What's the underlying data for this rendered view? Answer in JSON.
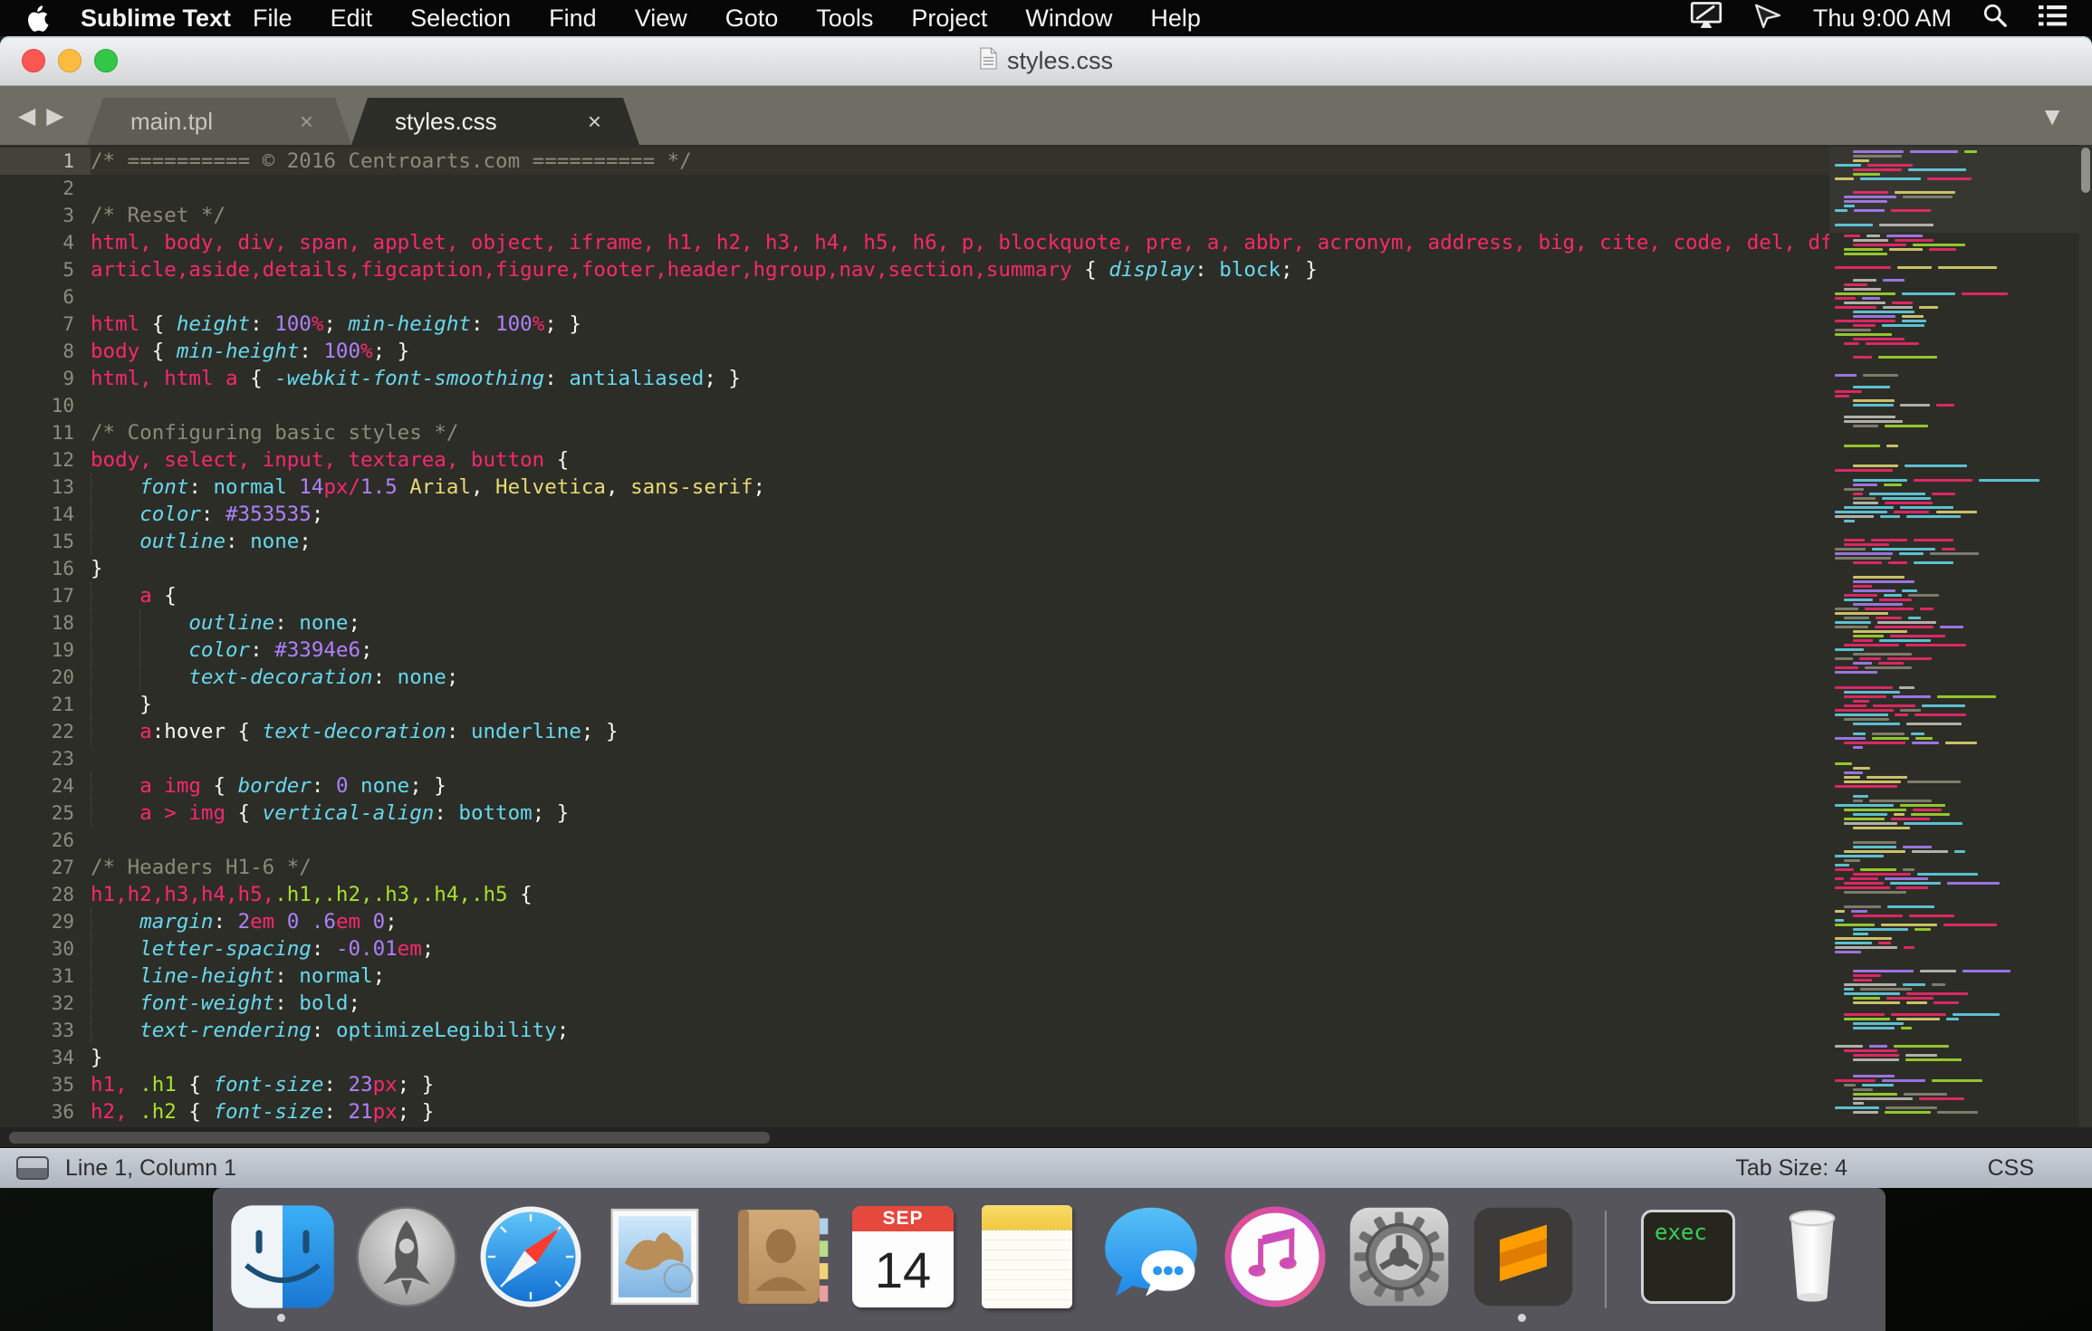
{
  "menu_bar": {
    "app_name": "Sublime Text",
    "items": [
      "File",
      "Edit",
      "Selection",
      "Find",
      "View",
      "Goto",
      "Tools",
      "Project",
      "Window",
      "Help"
    ],
    "clock": "Thu 9:00 AM"
  },
  "window": {
    "title": "styles.css"
  },
  "tab_bar": {
    "close_glyph": "×",
    "back_glyph": "◀",
    "forward_glyph": "▶",
    "overflow_glyph": "▼",
    "tabs": [
      {
        "label": "main.tpl",
        "active": false
      },
      {
        "label": "styles.css",
        "active": true
      }
    ]
  },
  "status_bar": {
    "position": "Line 1, Column 1",
    "tab_size": "Tab Size: 4",
    "syntax": "CSS"
  },
  "colors": {
    "editor_bg": "#2d2d27",
    "comment": "#8b8b79",
    "selector_pink": "#f9286e",
    "class_green": "#a6e22e",
    "property_cyan": "#66d9ef",
    "number_purple": "#ae81ff",
    "string_yellow": "#e6db74",
    "plain_white": "#f8f8f2"
  },
  "editor": {
    "lines": [
      {
        "n": 1,
        "i": 0,
        "t": [
          [
            "c",
            "/* ========== © 2016 Centroarts.com ========== */"
          ]
        ]
      },
      {
        "n": 2,
        "i": 0,
        "t": []
      },
      {
        "n": 3,
        "i": 0,
        "t": [
          [
            "c",
            "/* Reset */"
          ]
        ]
      },
      {
        "n": 4,
        "i": 0,
        "t": [
          [
            "s",
            "html, body, div, span, applet, object, iframe, h1, h2, h3, h4, h5, h6, p, blockquote, pre, a, abbr, acronym, address, big, cite, code, del, dfn"
          ]
        ]
      },
      {
        "n": 5,
        "i": 0,
        "t": [
          [
            "s",
            "article,aside,details,figcaption,figure,footer,header,hgroup,nav,section,summary"
          ],
          [
            "w",
            " { "
          ],
          [
            "p",
            "display"
          ],
          [
            "w",
            ": "
          ],
          [
            "k",
            "block"
          ],
          [
            "w",
            "; }"
          ]
        ]
      },
      {
        "n": 6,
        "i": 0,
        "t": []
      },
      {
        "n": 7,
        "i": 0,
        "t": [
          [
            "s",
            "html"
          ],
          [
            "w",
            " { "
          ],
          [
            "p",
            "height"
          ],
          [
            "w",
            ": "
          ],
          [
            "n",
            "100"
          ],
          [
            "u",
            "%"
          ],
          [
            "w",
            "; "
          ],
          [
            "p",
            "min-height"
          ],
          [
            "w",
            ": "
          ],
          [
            "n",
            "100"
          ],
          [
            "u",
            "%"
          ],
          [
            "w",
            "; }"
          ]
        ]
      },
      {
        "n": 8,
        "i": 0,
        "t": [
          [
            "s",
            "body"
          ],
          [
            "w",
            " { "
          ],
          [
            "p",
            "min-height"
          ],
          [
            "w",
            ": "
          ],
          [
            "n",
            "100"
          ],
          [
            "u",
            "%"
          ],
          [
            "w",
            "; }"
          ]
        ]
      },
      {
        "n": 9,
        "i": 0,
        "t": [
          [
            "s",
            "html, html a"
          ],
          [
            "w",
            " { "
          ],
          [
            "p",
            "-webkit-font-smoothing"
          ],
          [
            "w",
            ": "
          ],
          [
            "k",
            "antialiased"
          ],
          [
            "w",
            "; }"
          ]
        ]
      },
      {
        "n": 10,
        "i": 0,
        "t": []
      },
      {
        "n": 11,
        "i": 0,
        "t": [
          [
            "c",
            "/* Configuring basic styles */"
          ]
        ]
      },
      {
        "n": 12,
        "i": 0,
        "t": [
          [
            "s",
            "body, select, input, textarea, button"
          ],
          [
            "w",
            " {"
          ]
        ]
      },
      {
        "n": 13,
        "i": 1,
        "t": [
          [
            "w",
            "    "
          ],
          [
            "p",
            "font"
          ],
          [
            "w",
            ": "
          ],
          [
            "k",
            "normal"
          ],
          [
            "w",
            " "
          ],
          [
            "n",
            "14"
          ],
          [
            "u",
            "px"
          ],
          [
            "o",
            "/"
          ],
          [
            "n",
            "1.5"
          ],
          [
            "w",
            " "
          ],
          [
            "y",
            "Arial"
          ],
          [
            "w",
            ", "
          ],
          [
            "y",
            "Helvetica"
          ],
          [
            "w",
            ", "
          ],
          [
            "y",
            "sans-serif"
          ],
          [
            "w",
            ";"
          ]
        ]
      },
      {
        "n": 14,
        "i": 1,
        "t": [
          [
            "w",
            "    "
          ],
          [
            "p",
            "color"
          ],
          [
            "w",
            ": "
          ],
          [
            "n",
            "#353535"
          ],
          [
            "w",
            ";"
          ]
        ]
      },
      {
        "n": 15,
        "i": 1,
        "t": [
          [
            "w",
            "    "
          ],
          [
            "p",
            "outline"
          ],
          [
            "w",
            ": "
          ],
          [
            "k",
            "none"
          ],
          [
            "w",
            ";"
          ]
        ]
      },
      {
        "n": 16,
        "i": 0,
        "t": [
          [
            "w",
            "}"
          ]
        ]
      },
      {
        "n": 17,
        "i": 1,
        "t": [
          [
            "w",
            "    "
          ],
          [
            "s",
            "a"
          ],
          [
            "w",
            " {"
          ]
        ]
      },
      {
        "n": 18,
        "i": 2,
        "t": [
          [
            "w",
            "        "
          ],
          [
            "p",
            "outline"
          ],
          [
            "w",
            ": "
          ],
          [
            "k",
            "none"
          ],
          [
            "w",
            ";"
          ]
        ]
      },
      {
        "n": 19,
        "i": 2,
        "t": [
          [
            "w",
            "        "
          ],
          [
            "p",
            "color"
          ],
          [
            "w",
            ": "
          ],
          [
            "n",
            "#3394e6"
          ],
          [
            "w",
            ";"
          ]
        ]
      },
      {
        "n": 20,
        "i": 2,
        "t": [
          [
            "w",
            "        "
          ],
          [
            "p",
            "text-decoration"
          ],
          [
            "w",
            ": "
          ],
          [
            "k",
            "none"
          ],
          [
            "w",
            ";"
          ]
        ]
      },
      {
        "n": 21,
        "i": 1,
        "t": [
          [
            "w",
            "    "
          ],
          [
            "w",
            "}"
          ]
        ]
      },
      {
        "n": 22,
        "i": 1,
        "t": [
          [
            "w",
            "    "
          ],
          [
            "s",
            "a"
          ],
          [
            "w",
            ":hover { "
          ],
          [
            "p",
            "text-decoration"
          ],
          [
            "w",
            ": "
          ],
          [
            "k",
            "underline"
          ],
          [
            "w",
            "; }"
          ]
        ]
      },
      {
        "n": 23,
        "i": 0,
        "t": []
      },
      {
        "n": 24,
        "i": 1,
        "t": [
          [
            "w",
            "    "
          ],
          [
            "s",
            "a img"
          ],
          [
            "w",
            " { "
          ],
          [
            "p",
            "border"
          ],
          [
            "w",
            ": "
          ],
          [
            "n",
            "0"
          ],
          [
            "w",
            " "
          ],
          [
            "k",
            "none"
          ],
          [
            "w",
            "; }"
          ]
        ]
      },
      {
        "n": 25,
        "i": 1,
        "t": [
          [
            "w",
            "    "
          ],
          [
            "s",
            "a"
          ],
          [
            "w",
            " "
          ],
          [
            "o",
            ">"
          ],
          [
            "w",
            " "
          ],
          [
            "s",
            "img"
          ],
          [
            "w",
            " { "
          ],
          [
            "p",
            "vertical-align"
          ],
          [
            "w",
            ": "
          ],
          [
            "k",
            "bottom"
          ],
          [
            "w",
            "; }"
          ]
        ]
      },
      {
        "n": 26,
        "i": 0,
        "t": []
      },
      {
        "n": 27,
        "i": 0,
        "t": [
          [
            "c",
            "/* Headers H1-6 */"
          ]
        ]
      },
      {
        "n": 28,
        "i": 0,
        "t": [
          [
            "s",
            "h1,h2,h3,h4,h5,"
          ],
          [
            "g",
            ".h1,.h2,.h3,.h4,.h5"
          ],
          [
            "w",
            " {"
          ]
        ]
      },
      {
        "n": 29,
        "i": 1,
        "t": [
          [
            "w",
            "    "
          ],
          [
            "p",
            "margin"
          ],
          [
            "w",
            ": "
          ],
          [
            "n",
            "2"
          ],
          [
            "u",
            "em"
          ],
          [
            "w",
            " "
          ],
          [
            "n",
            "0"
          ],
          [
            "w",
            " "
          ],
          [
            "n",
            ".6"
          ],
          [
            "u",
            "em"
          ],
          [
            "w",
            " "
          ],
          [
            "n",
            "0"
          ],
          [
            "w",
            ";"
          ]
        ]
      },
      {
        "n": 30,
        "i": 1,
        "t": [
          [
            "w",
            "    "
          ],
          [
            "p",
            "letter-spacing"
          ],
          [
            "w",
            ": "
          ],
          [
            "n",
            "-0.01"
          ],
          [
            "u",
            "em"
          ],
          [
            "w",
            ";"
          ]
        ]
      },
      {
        "n": 31,
        "i": 1,
        "t": [
          [
            "w",
            "    "
          ],
          [
            "p",
            "line-height"
          ],
          [
            "w",
            ": "
          ],
          [
            "k",
            "normal"
          ],
          [
            "w",
            ";"
          ]
        ]
      },
      {
        "n": 32,
        "i": 1,
        "t": [
          [
            "w",
            "    "
          ],
          [
            "p",
            "font-weight"
          ],
          [
            "w",
            ": "
          ],
          [
            "k",
            "bold"
          ],
          [
            "w",
            ";"
          ]
        ]
      },
      {
        "n": 33,
        "i": 1,
        "t": [
          [
            "w",
            "    "
          ],
          [
            "p",
            "text-rendering"
          ],
          [
            "w",
            ": "
          ],
          [
            "k",
            "optimizeLegibility"
          ],
          [
            "w",
            ";"
          ]
        ]
      },
      {
        "n": 34,
        "i": 0,
        "t": [
          [
            "w",
            "}"
          ]
        ]
      },
      {
        "n": 35,
        "i": 0,
        "t": [
          [
            "s",
            "h1,"
          ],
          [
            "w",
            " "
          ],
          [
            "g",
            ".h1"
          ],
          [
            "w",
            " { "
          ],
          [
            "p",
            "font-size"
          ],
          [
            "w",
            ": "
          ],
          [
            "n",
            "23"
          ],
          [
            "u",
            "px"
          ],
          [
            "w",
            "; }"
          ]
        ]
      },
      {
        "n": 36,
        "i": 0,
        "t": [
          [
            "s",
            "h2,"
          ],
          [
            "w",
            " "
          ],
          [
            "g",
            ".h2"
          ],
          [
            "w",
            " { "
          ],
          [
            "p",
            "font-size"
          ],
          [
            "w",
            ": "
          ],
          [
            "n",
            "21"
          ],
          [
            "u",
            "px"
          ],
          [
            "w",
            "; }"
          ]
        ]
      }
    ]
  },
  "dock": {
    "items": [
      {
        "name": "finder",
        "running": true
      },
      {
        "name": "launchpad"
      },
      {
        "name": "safari"
      },
      {
        "name": "mail"
      },
      {
        "name": "contacts"
      },
      {
        "name": "calendar",
        "month": "SEP",
        "day": "14"
      },
      {
        "name": "notes"
      },
      {
        "name": "messages"
      },
      {
        "name": "itunes"
      },
      {
        "name": "system-preferences"
      },
      {
        "name": "sublime-text",
        "running": true
      },
      {
        "name": "divider"
      },
      {
        "name": "exec",
        "label": "exec"
      },
      {
        "name": "trash"
      }
    ]
  }
}
